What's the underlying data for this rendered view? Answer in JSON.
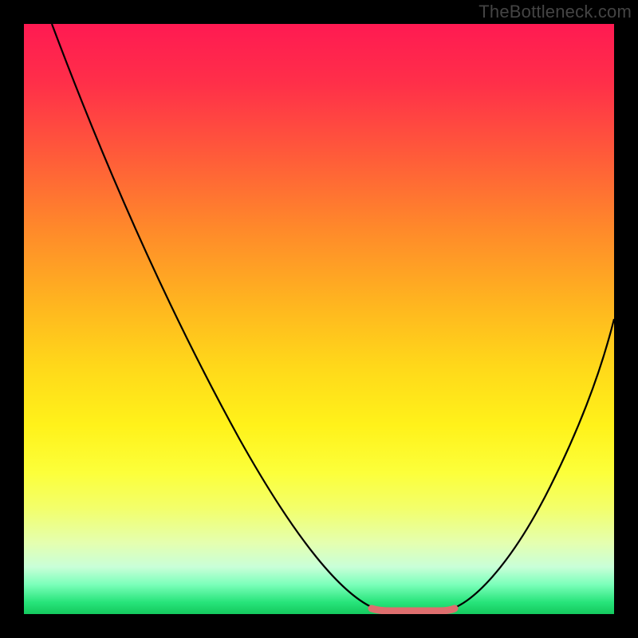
{
  "watermark": "TheBottleneck.com",
  "colors": {
    "frame": "#000000",
    "curve": "#000000",
    "highlight": "#de6e6e",
    "gradient_stops": [
      "#ff1a52",
      "#ff2f49",
      "#ff5a3a",
      "#ff8a2a",
      "#ffb71f",
      "#ffd81a",
      "#fff21a",
      "#fcff3a",
      "#f3ff6a",
      "#e4ffb0",
      "#c9ffd8",
      "#7bffba",
      "#27e47a",
      "#14c95e"
    ]
  },
  "chart_data": {
    "type": "line",
    "title": "",
    "xlabel": "",
    "ylabel": "",
    "xlim": [
      0,
      100
    ],
    "ylim": [
      0,
      100
    ],
    "x": [
      0,
      5,
      10,
      15,
      20,
      25,
      30,
      35,
      40,
      45,
      50,
      55,
      58,
      62,
      66,
      70,
      72,
      76,
      80,
      85,
      90,
      95,
      100
    ],
    "values": [
      99,
      92,
      84,
      76,
      68,
      60,
      52,
      44,
      36,
      28,
      20,
      12,
      6,
      2,
      0,
      0,
      0,
      2,
      7,
      15,
      25,
      37,
      50
    ],
    "highlight_range_x": [
      58,
      72
    ],
    "notes": "V-shaped curve descending from top-left, reaching ~0 near x=64-70, then rising toward the right; flat bottom segment highlighted in salmon."
  }
}
